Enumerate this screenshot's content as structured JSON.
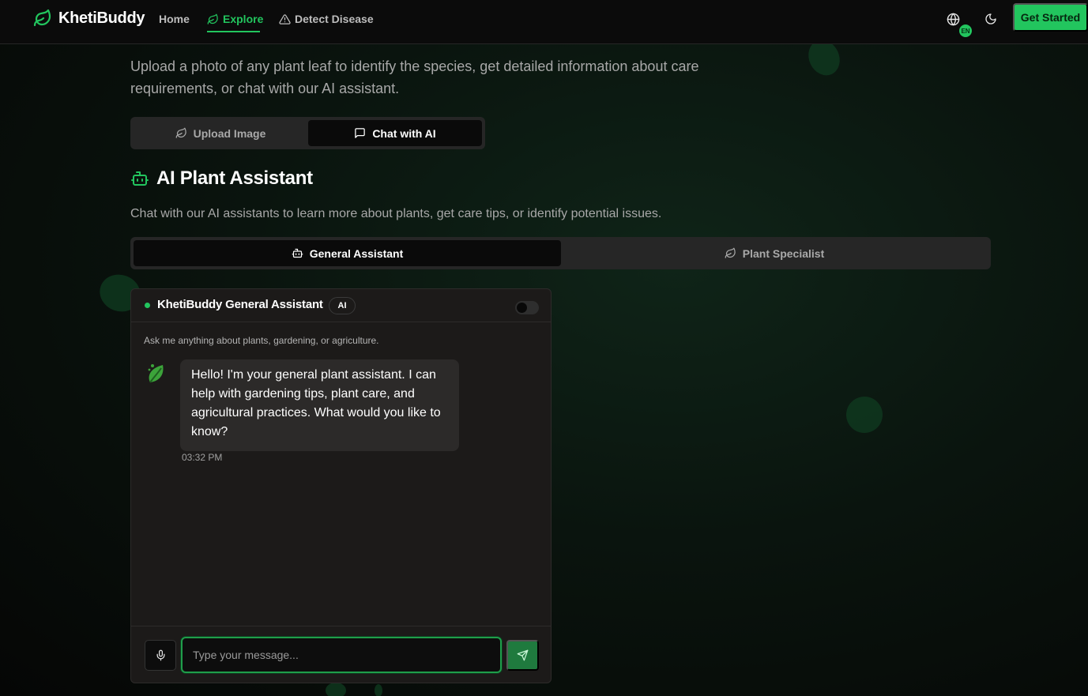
{
  "nav": {
    "brand": "KhetiBuddy",
    "links": [
      {
        "label": "Home"
      },
      {
        "label": "Explore"
      },
      {
        "label": "Detect Disease"
      }
    ],
    "language_badge": "EN",
    "cta_label": "Get Started"
  },
  "intro": {
    "text": "Upload a photo of any plant leaf to identify the species, get detailed information about care requirements, or chat with our AI assistant."
  },
  "mode_tabs": [
    {
      "label": "Upload Image"
    },
    {
      "label": "Chat with AI"
    }
  ],
  "section": {
    "title": "AI Plant Assistant",
    "description": "Chat with our AI assistants to learn more about plants, get care tips, or identify potential issues."
  },
  "assistant_tabs": [
    {
      "label": "General Assistant"
    },
    {
      "label": "Plant Specialist"
    }
  ],
  "chat": {
    "title": "KhetiBuddy General Assistant",
    "badge": "AI",
    "hint": "Ask me anything about plants, gardening, or agriculture.",
    "messages": [
      {
        "text": "Hello! I'm your general plant assistant. I can help with gardening tips, plant care, and agricultural practices. What would you like to know?",
        "time": "03:32 PM"
      }
    ],
    "input_placeholder": "Type your message..."
  },
  "colors": {
    "accent": "#22c55e",
    "send_button": "#1f7a3e",
    "card": "#1c1a19",
    "bubble": "#2c2a29"
  }
}
